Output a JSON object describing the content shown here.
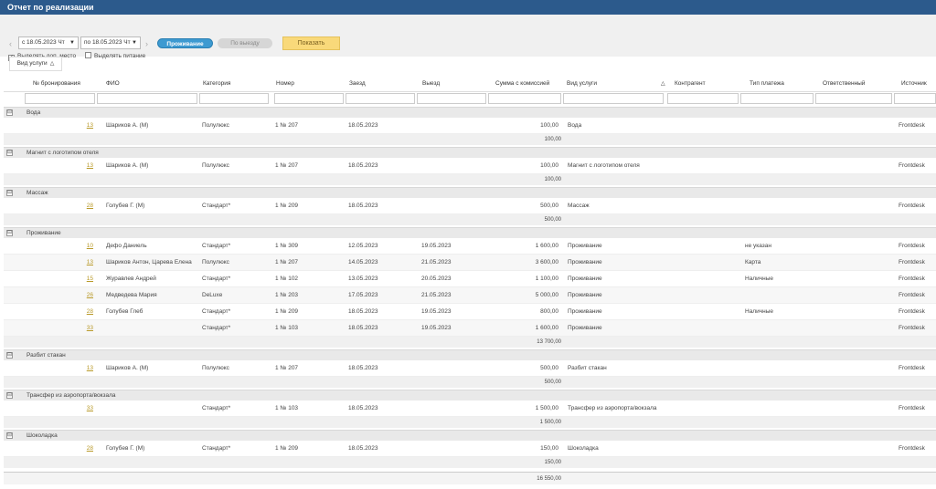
{
  "title": "Отчет по реализации",
  "toolbar": {
    "date_from": "с 18.05.2023 Чт",
    "date_to": "по 18.05.2023 Чт",
    "prev_arrow": "‹",
    "next_arrow": "›",
    "mode_active": "Проживание",
    "mode_inactive": "По выезду",
    "show_button": "Показать",
    "checkbox_extra_place": "Выделять доп. место",
    "checkbox_extra_place_checked": true,
    "checkbox_food": "Выделять питание",
    "checkbox_food_checked": false,
    "group_by": "Вид услуги",
    "group_by_icon": "sort-asc-icon"
  },
  "columns": [
    "№ бронирования",
    "ФИО",
    "Категория",
    "Номер",
    "Заезд",
    "Выезд",
    "Сумма с комиссией",
    "Вид услуги",
    "Контрагент",
    "Тип платежа",
    "Ответственный",
    "Источник"
  ],
  "groups": [
    {
      "name": "Вода",
      "rows": [
        {
          "id": "13",
          "fio": "Шариков А. (М)",
          "cat": "Полулюкс",
          "room": "1 № 207",
          "in": "18.05.2023",
          "out": "",
          "sum": "100,00",
          "svc": "Вода",
          "pay": "",
          "src": "Frontdesk"
        }
      ],
      "subtotal": "100,00"
    },
    {
      "name": "Магнит с логотипом отеля",
      "rows": [
        {
          "id": "13",
          "fio": "Шариков А. (М)",
          "cat": "Полулюкс",
          "room": "1 № 207",
          "in": "18.05.2023",
          "out": "",
          "sum": "100,00",
          "svc": "Магнит с логотипом отеля",
          "pay": "",
          "src": "Frontdesk"
        }
      ],
      "subtotal": "100,00"
    },
    {
      "name": "Массаж",
      "rows": [
        {
          "id": "28",
          "fio": "Голубев Г. (М)",
          "cat": "Стандарт*",
          "room": "1 № 209",
          "in": "18.05.2023",
          "out": "",
          "sum": "500,00",
          "svc": "Массаж",
          "pay": "",
          "src": "Frontdesk"
        }
      ],
      "subtotal": "500,00"
    },
    {
      "name": "Проживание",
      "rows": [
        {
          "id": "10",
          "fio": "Дефо Даниель",
          "cat": "Стандарт*",
          "room": "1 № 309",
          "in": "12.05.2023",
          "out": "19.05.2023",
          "sum": "1 600,00",
          "svc": "Проживание",
          "pay": "не указан",
          "src": "Frontdesk"
        },
        {
          "id": "13",
          "fio": "Шариков Антон, Царева Елена",
          "cat": "Полулюкс",
          "room": "1 № 207",
          "in": "14.05.2023",
          "out": "21.05.2023",
          "sum": "3 600,00",
          "svc": "Проживание",
          "pay": "Карта",
          "src": "Frontdesk"
        },
        {
          "id": "15",
          "fio": "Журавлев Андрей",
          "cat": "Стандарт*",
          "room": "1 № 102",
          "in": "13.05.2023",
          "out": "20.05.2023",
          "sum": "1 100,00",
          "svc": "Проживание",
          "pay": "Наличные",
          "src": "Frontdesk"
        },
        {
          "id": "26",
          "fio": "Медведева Мария",
          "cat": "DeLuxe",
          "room": "1 № 203",
          "in": "17.05.2023",
          "out": "21.05.2023",
          "sum": "5 000,00",
          "svc": "Проживание",
          "pay": "",
          "src": "Frontdesk"
        },
        {
          "id": "28",
          "fio": "Голубев Глеб",
          "cat": "Стандарт*",
          "room": "1 № 209",
          "in": "18.05.2023",
          "out": "19.05.2023",
          "sum": "800,00",
          "svc": "Проживание",
          "pay": "Наличные",
          "src": "Frontdesk"
        },
        {
          "id": "33",
          "fio": "",
          "cat": "Стандарт*",
          "room": "1 № 103",
          "in": "18.05.2023",
          "out": "19.05.2023",
          "sum": "1 600,00",
          "svc": "Проживание",
          "pay": "",
          "src": "Frontdesk"
        }
      ],
      "subtotal": "13 700,00"
    },
    {
      "name": "Разбит стакан",
      "rows": [
        {
          "id": "13",
          "fio": "Шариков А. (М)",
          "cat": "Полулюкс",
          "room": "1 № 207",
          "in": "18.05.2023",
          "out": "",
          "sum": "500,00",
          "svc": "Разбит стакан",
          "pay": "",
          "src": "Frontdesk"
        }
      ],
      "subtotal": "500,00"
    },
    {
      "name": "Трансфер из аэропорта/вокзала",
      "rows": [
        {
          "id": "33",
          "fio": "",
          "cat": "Стандарт*",
          "room": "1 № 103",
          "in": "18.05.2023",
          "out": "",
          "sum": "1 500,00",
          "svc": "Трансфер из аэропорта/вокзала",
          "pay": "",
          "src": "Frontdesk"
        }
      ],
      "subtotal": "1 500,00"
    },
    {
      "name": "Шоколадка",
      "rows": [
        {
          "id": "28",
          "fio": "Голубев Г. (М)",
          "cat": "Стандарт*",
          "room": "1 № 209",
          "in": "18.05.2023",
          "out": "",
          "sum": "150,00",
          "svc": "Шоколадка",
          "pay": "",
          "src": "Frontdesk"
        }
      ],
      "subtotal": "150,00"
    }
  ],
  "grand_total": "16 550,00",
  "colors": {
    "titlebar": "#2c5a8c",
    "active_pill": "#3d9ad1",
    "show_button": "#f9d97a",
    "link": "#b99a2a"
  }
}
